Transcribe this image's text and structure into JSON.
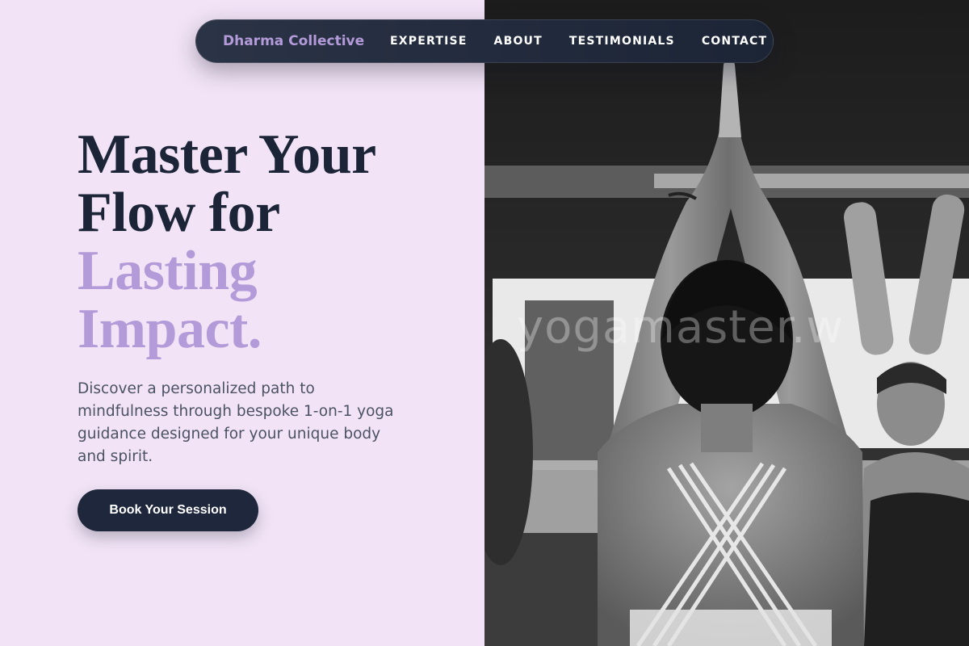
{
  "nav": {
    "brand": "Dharma Collective",
    "links": [
      "EXPERTISE",
      "ABOUT",
      "TESTIMONIALS",
      "CONTACT"
    ]
  },
  "hero": {
    "headline_line1": "Master Your",
    "headline_line2": "Flow for",
    "headline_accent_line1": "Lasting",
    "headline_accent_line2": "Impact.",
    "description": "Discover a personalized path to mindfulness through bespoke 1-on-1 yoga guidance designed for your unique body and spirit.",
    "cta_label": "Book Your Session"
  },
  "image": {
    "watermark": "yogamaster.w"
  },
  "colors": {
    "background": "#f2e4f6",
    "accent": "#b39ad8",
    "dark": "#1e273b",
    "text_body": "#4a5264"
  }
}
